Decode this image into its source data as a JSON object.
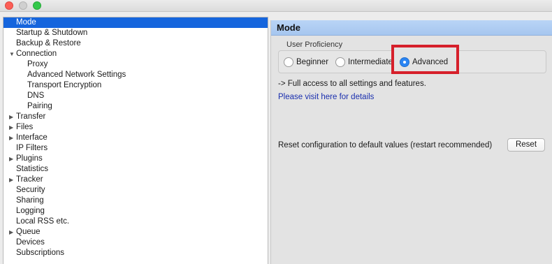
{
  "titlebar": {
    "traffic_lights": {
      "close_color": "#fc5f57",
      "minimize_color": "#d0d0d0",
      "zoom_color": "#34c84a"
    }
  },
  "sidebar": {
    "selection_color": "#1565dd",
    "items": [
      {
        "label": "Mode",
        "selected": true,
        "expandable": false,
        "expanded": false,
        "level": 0
      },
      {
        "label": "Startup & Shutdown",
        "selected": false,
        "expandable": false,
        "expanded": false,
        "level": 0
      },
      {
        "label": "Backup & Restore",
        "selected": false,
        "expandable": false,
        "expanded": false,
        "level": 0
      },
      {
        "label": "Connection",
        "selected": false,
        "expandable": true,
        "expanded": true,
        "level": 0
      },
      {
        "label": "Proxy",
        "selected": false,
        "expandable": false,
        "expanded": false,
        "level": 1
      },
      {
        "label": "Advanced Network Settings",
        "selected": false,
        "expandable": false,
        "expanded": false,
        "level": 1
      },
      {
        "label": "Transport Encryption",
        "selected": false,
        "expandable": false,
        "expanded": false,
        "level": 1
      },
      {
        "label": "DNS",
        "selected": false,
        "expandable": false,
        "expanded": false,
        "level": 1
      },
      {
        "label": "Pairing",
        "selected": false,
        "expandable": false,
        "expanded": false,
        "level": 1
      },
      {
        "label": "Transfer",
        "selected": false,
        "expandable": true,
        "expanded": false,
        "level": 0
      },
      {
        "label": "Files",
        "selected": false,
        "expandable": true,
        "expanded": false,
        "level": 0
      },
      {
        "label": "Interface",
        "selected": false,
        "expandable": true,
        "expanded": false,
        "level": 0
      },
      {
        "label": "IP Filters",
        "selected": false,
        "expandable": false,
        "expanded": false,
        "level": 0
      },
      {
        "label": "Plugins",
        "selected": false,
        "expandable": true,
        "expanded": false,
        "level": 0
      },
      {
        "label": "Statistics",
        "selected": false,
        "expandable": false,
        "expanded": false,
        "level": 0
      },
      {
        "label": "Tracker",
        "selected": false,
        "expandable": true,
        "expanded": false,
        "level": 0
      },
      {
        "label": "Security",
        "selected": false,
        "expandable": false,
        "expanded": false,
        "level": 0
      },
      {
        "label": "Sharing",
        "selected": false,
        "expandable": false,
        "expanded": false,
        "level": 0
      },
      {
        "label": "Logging",
        "selected": false,
        "expandable": false,
        "expanded": false,
        "level": 0
      },
      {
        "label": "Local RSS etc.",
        "selected": false,
        "expandable": false,
        "expanded": false,
        "level": 0
      },
      {
        "label": "Queue",
        "selected": false,
        "expandable": true,
        "expanded": false,
        "level": 0
      },
      {
        "label": "Devices",
        "selected": false,
        "expandable": false,
        "expanded": false,
        "level": 0
      },
      {
        "label": "Subscriptions",
        "selected": false,
        "expandable": false,
        "expanded": false,
        "level": 0
      }
    ]
  },
  "panel": {
    "title": "Mode",
    "header_color": "#b9d4f6",
    "proficiency": {
      "legend": "User Proficiency",
      "options": [
        {
          "label": "Beginner",
          "checked": false
        },
        {
          "label": "Intermediate",
          "checked": false
        },
        {
          "label": "Advanced",
          "checked": true
        }
      ],
      "visible_labels": [
        "Beginner",
        "Intermediate",
        "Advanced"
      ],
      "highlight_color": "#d6202b"
    },
    "description": "-> Full access to all settings and features.",
    "details_link": "Please visit here for details",
    "reset": {
      "text": "Reset configuration to default values (restart recommended)",
      "button_label": "Reset"
    }
  }
}
